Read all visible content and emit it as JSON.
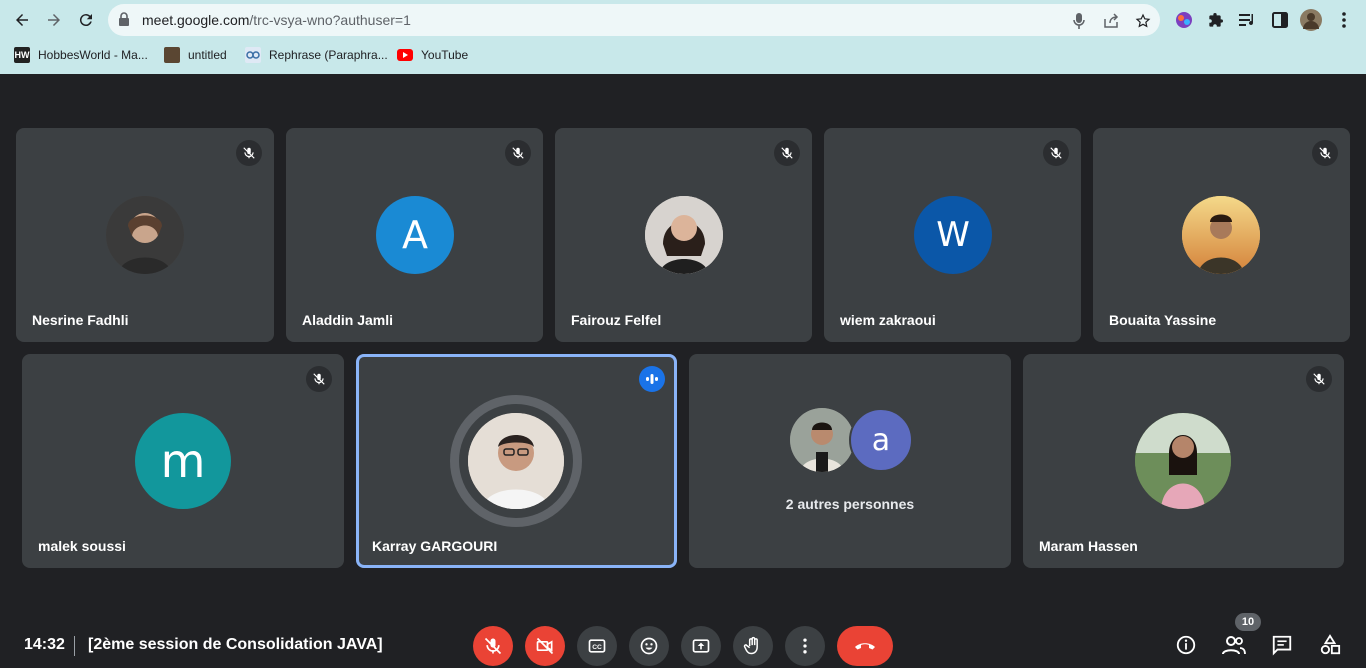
{
  "browser": {
    "url_host": "meet.google.com",
    "url_path": "/trc-vsya-wno?authuser=1",
    "bookmarks": [
      {
        "label": "HobbesWorld - Ma...",
        "fav_text": "HW",
        "fav_color": "#222222"
      },
      {
        "label": "untitled",
        "fav_text": "",
        "fav_color": "#5a4632"
      },
      {
        "label": "Rephrase (Paraphra...",
        "fav_text": "",
        "fav_color": "#3a6ea5"
      },
      {
        "label": "YouTube",
        "fav_text": "",
        "fav_color": "#ff0000"
      }
    ]
  },
  "participants": [
    {
      "name": "Nesrine Fadhli",
      "avatar": "photo",
      "color": "#4a4a4a",
      "muted": true
    },
    {
      "name": "Aladdin Jamli",
      "avatar": "letter",
      "letter": "A",
      "color": "#1a8ad4",
      "muted": true
    },
    {
      "name": "Fairouz Felfel",
      "avatar": "photo",
      "color": "#6b5a52",
      "muted": true
    },
    {
      "name": "wiem zakraoui",
      "avatar": "letter",
      "letter": "W",
      "color": "#0b57a8",
      "muted": true
    },
    {
      "name": "Bouaita Yassine",
      "avatar": "photo",
      "color": "#c89a5a",
      "muted": true
    },
    {
      "name": "malek soussi",
      "avatar": "letter",
      "letter": "m",
      "color": "#12979c",
      "muted": true
    },
    {
      "name": "Karray GARGOURI",
      "avatar": "photo",
      "color": "#d9cfc4",
      "muted": false,
      "speaking": true
    },
    {
      "name": "Maram Hassen",
      "avatar": "photo",
      "color": "#5c7a4a",
      "muted": true
    }
  ],
  "others": {
    "label": "2 autres personnes",
    "letter": "a",
    "letter_color": "#5c6bc0"
  },
  "meeting": {
    "time": "14:32",
    "title": "[2ème session de Consolidation JAVA]",
    "participant_count": "10"
  },
  "colors": {
    "danger": "#ea4335",
    "speaking_outline": "#8ab4f8",
    "speaking_badge": "#1a73e8"
  }
}
